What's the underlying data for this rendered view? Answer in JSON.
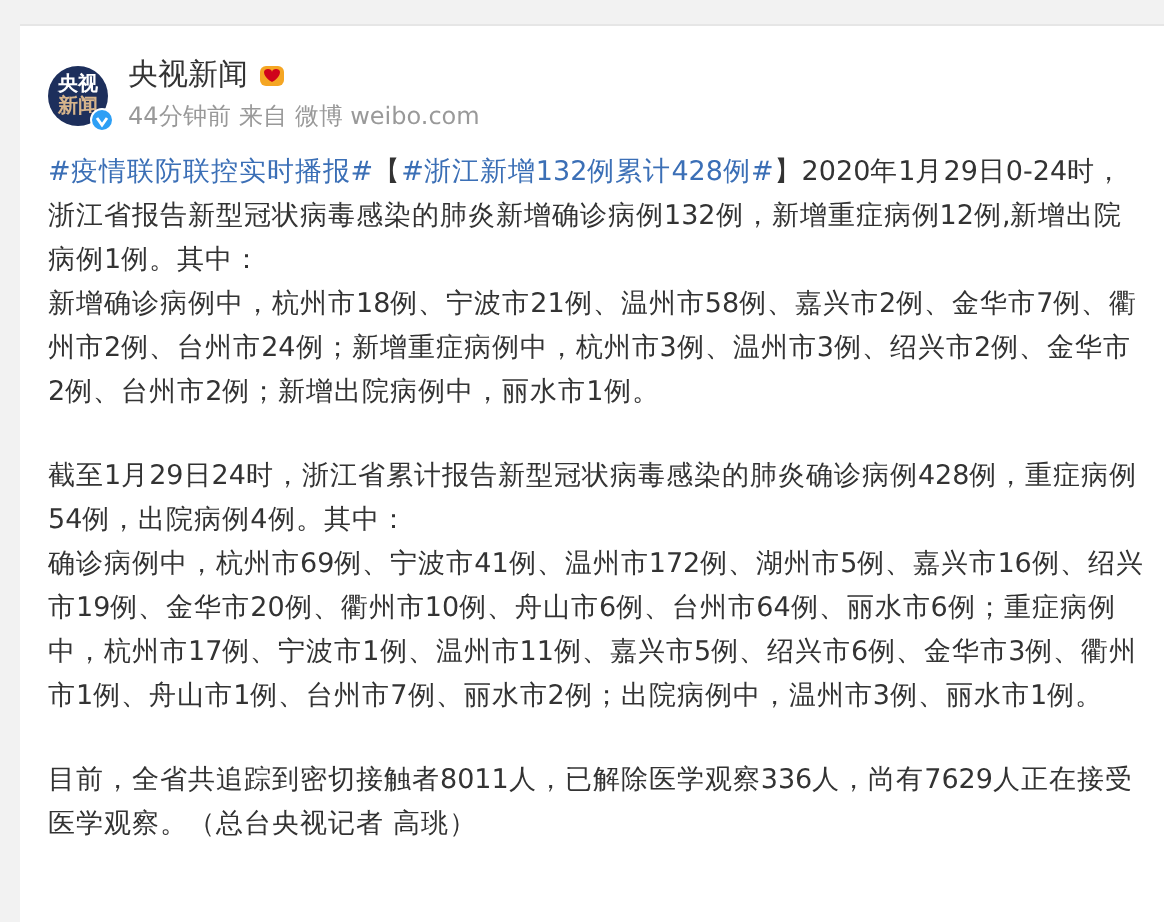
{
  "post": {
    "author": {
      "name": "央视新闻",
      "avatar_text": [
        "央视",
        "新闻"
      ],
      "verified": true
    },
    "meta": {
      "time": "44分钟前",
      "source_label": "来自",
      "source": "微博 weibo.com"
    },
    "sections": [
      [
        [
          {
            "kind": "hashtag",
            "text": "#疫情联防联控实时播报#"
          },
          {
            "kind": "text",
            "text": "【"
          },
          {
            "kind": "hashtag",
            "text": "#浙江新增132例累计428例#"
          },
          {
            "kind": "text",
            "text": "】2020年1月29日0-24时，浙江省报告新型冠状病毒感染的肺炎新增确诊病例132例，新增重症病例12例,新增出院病例1例。其中："
          }
        ],
        [
          {
            "kind": "text",
            "text": "新增确诊病例中，杭州市18例、宁波市21例、温州市58例、嘉兴市2例、金华市7例、衢州市2例、台州市24例；新增重症病例中，杭州市3例、温州市3例、绍兴市2例、金华市2例、台州市2例；新增出院病例中，丽水市1例。"
          }
        ]
      ],
      [
        [
          {
            "kind": "text",
            "text": "截至1月29日24时，浙江省累计报告新型冠状病毒感染的肺炎确诊病例428例，重症病例54例，出院病例4例。其中："
          }
        ],
        [
          {
            "kind": "text",
            "text": "确诊病例中，杭州市69例、宁波市41例、温州市172例、湖州市5例、嘉兴市16例、绍兴市19例、金华市20例、衢州市10例、舟山市6例、台州市64例、丽水市6例；重症病例中，杭州市17例、宁波市1例、温州市11例、嘉兴市5例、绍兴市6例、金华市3例、衢州市1例、舟山市1例、台州市7例、丽水市2例；出院病例中，温州市3例、丽水市1例。"
          }
        ]
      ],
      [
        [
          {
            "kind": "text",
            "text": "目前，全省共追踪到密切接触者8011人，已解除医学观察336人，尚有7629人正在接受医学观察。（总台央视记者 高珧）"
          }
        ]
      ]
    ]
  }
}
